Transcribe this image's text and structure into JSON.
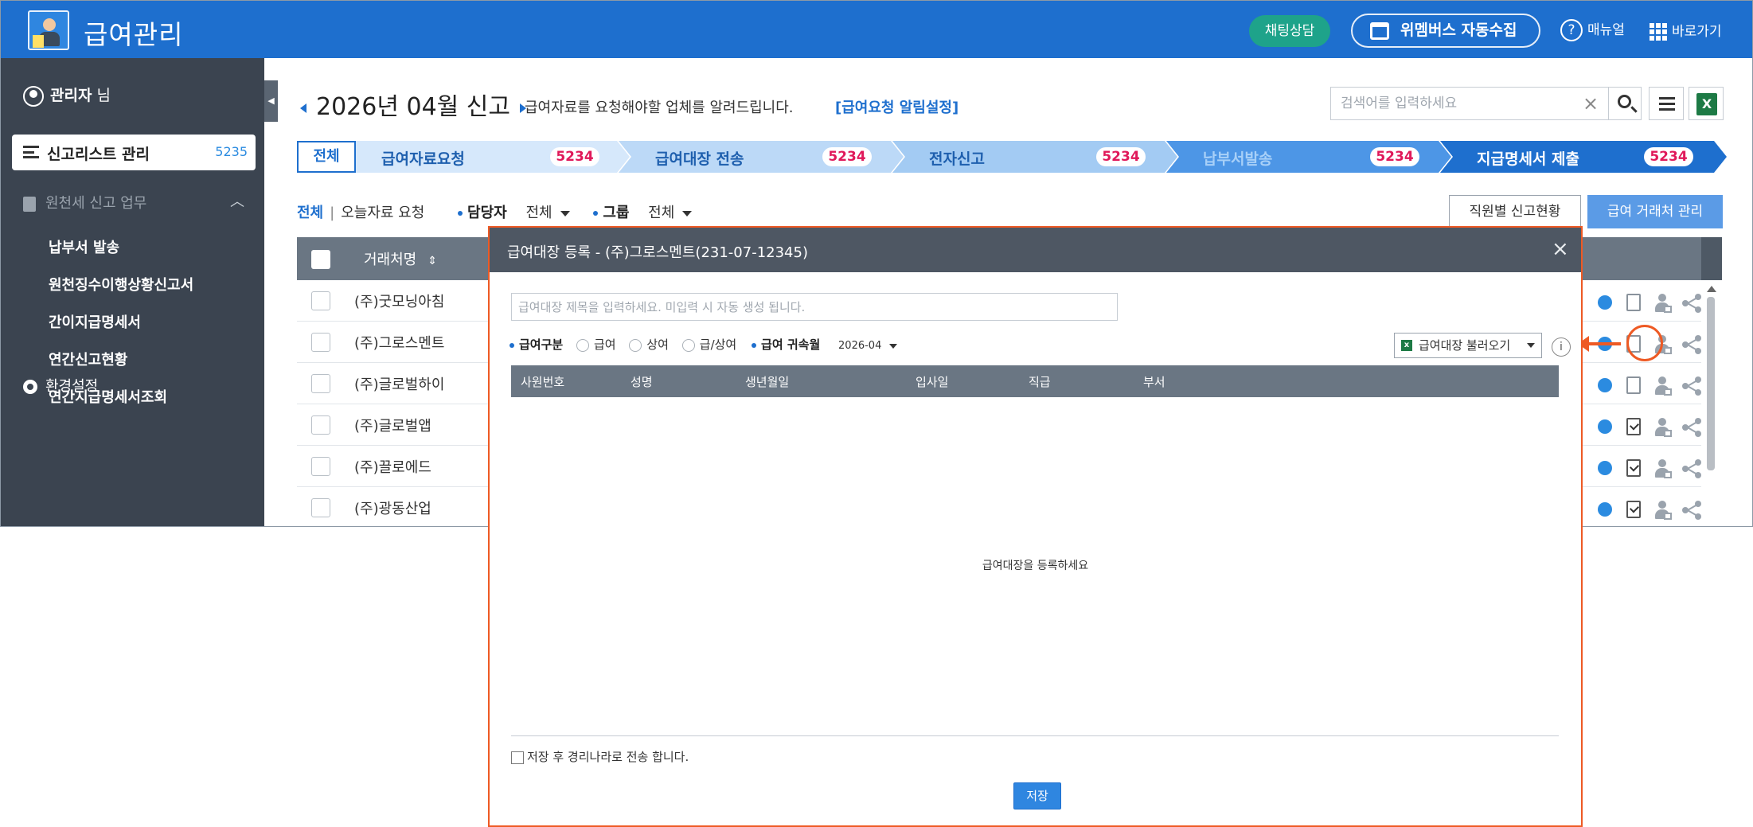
{
  "header": {
    "app_title": "급여관리",
    "chat_label": "채팅상담",
    "collect_label": "위멤버스 자동수집",
    "manual_label": "매뉴얼",
    "shortcut_label": "바로가기",
    "colors": {
      "bar": "#1e6fce",
      "chat": "#1ea38a"
    }
  },
  "sidebar": {
    "admin_name": "관리자",
    "admin_suffix": "님",
    "active_item": {
      "label": "신고리스트 관리",
      "count": "5235"
    },
    "section_label": "원천세 신고 업무",
    "items": [
      {
        "label": "납부서 발송"
      },
      {
        "label": "원천징수이행상황신고서"
      },
      {
        "label": "간이지급명세서"
      },
      {
        "label": "연간신고현황"
      },
      {
        "label": "연간지급명세서조회"
      }
    ],
    "settings_label": "환경설정"
  },
  "main": {
    "period": "2026년 04월 신고",
    "notice": "급여자료를 요청해야할 업체를 알려드립니다.",
    "notice_link": "[급여요청 알림설정]",
    "search_placeholder": "검색어를 입력하세요",
    "steps": {
      "all_label": "전체",
      "items": [
        {
          "label": "급여자료요청",
          "count": "5234"
        },
        {
          "label": "급여대장 전송",
          "count": "5234"
        },
        {
          "label": "전자신고",
          "count": "5234"
        },
        {
          "label": "납부서발송",
          "count": "5234"
        },
        {
          "label": "지급명세서 제출",
          "count": "5234"
        }
      ]
    },
    "filters": {
      "all": "전체",
      "today": "오늘자료 요청",
      "manager_label": "담당자",
      "manager_value": "전체",
      "group_label": "그룹",
      "group_value": "전체"
    },
    "emp_status_button": "직원별 신고현황",
    "client_button": "급여 거래처 관리",
    "table": {
      "header": "거래처명",
      "sort_icon": "⇕",
      "rows": [
        {
          "name": "(주)굿모닝아침"
        },
        {
          "name": "(주)그로스멘트"
        },
        {
          "name": "(주)글로벌하이"
        },
        {
          "name": "(주)글로벌앱"
        },
        {
          "name": "(주)끌로에드"
        },
        {
          "name": "(주)광동산업"
        }
      ]
    }
  },
  "modal": {
    "title": "급여대장 등록 - (주)그로스멘트(231-07-12345)",
    "close": "×",
    "title_placeholder": "급여대장 제목을 입력하세요. 미입력 시 자동 생성 됩니다.",
    "type_label": "급여구분",
    "type_options": [
      "급여",
      "상여",
      "급/상여"
    ],
    "month_label": "급여 귀속월",
    "month_value": "2026-04",
    "load_button": "급여대장 불러오기",
    "info": "i",
    "columns": [
      "사원번호",
      "성명",
      "생년월일",
      "입사일",
      "직급",
      "부서"
    ],
    "empty_text": "급여대장을 등록하세요",
    "send_option": "저장 후 경리나라로 전송 합니다.",
    "save_button": "저장"
  }
}
